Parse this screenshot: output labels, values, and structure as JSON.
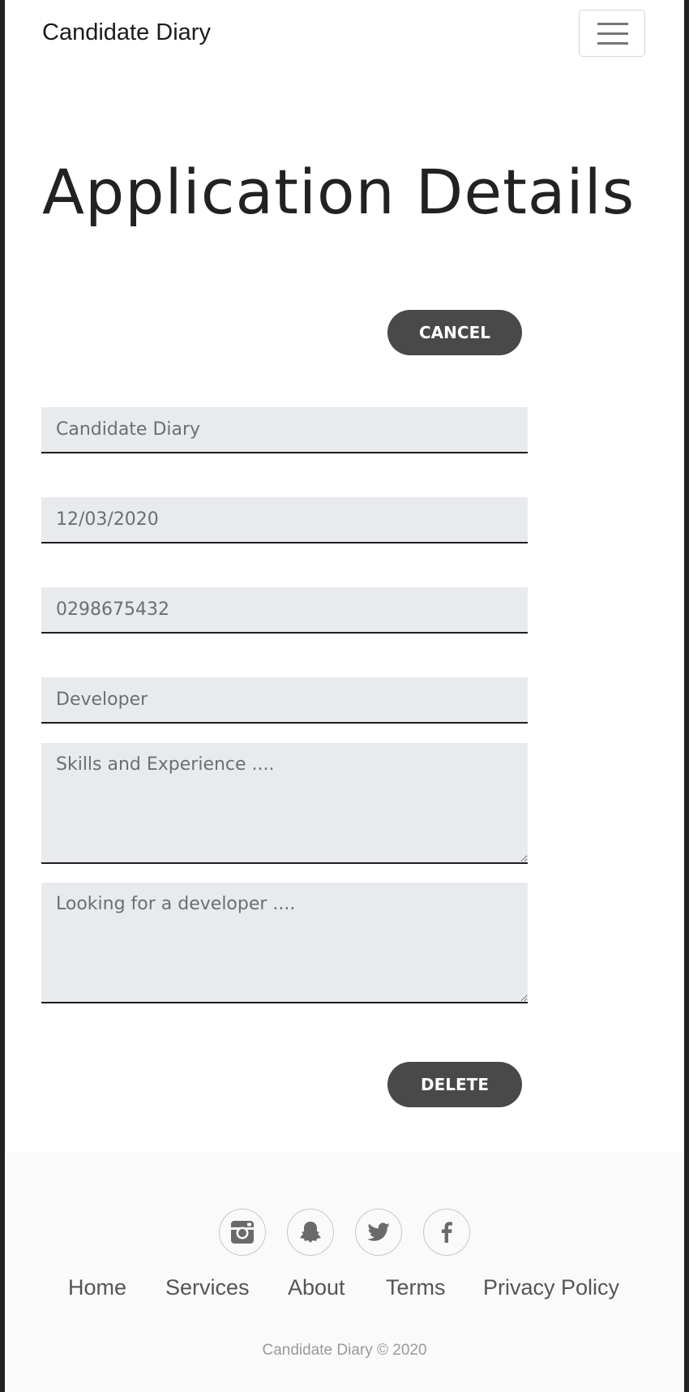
{
  "navbar": {
    "brand": "Candidate Diary",
    "menu_icon": "hamburger-menu-icon"
  },
  "page": {
    "title": "Application Details"
  },
  "buttons": {
    "cancel_label": "CANCEL",
    "delete_label": "DELETE"
  },
  "form": {
    "company_placeholder": "Candidate Diary",
    "date_placeholder": "12/03/2020",
    "phone_placeholder": "0298675432",
    "role_placeholder": "Developer",
    "skills_placeholder": "Skills and Experience ....",
    "notes_placeholder": "Looking for a developer ...."
  },
  "footer": {
    "social": [
      {
        "icon": "instagram-icon"
      },
      {
        "icon": "snapchat-icon"
      },
      {
        "icon": "twitter-icon"
      },
      {
        "icon": "facebook-icon"
      }
    ],
    "links": [
      "Home",
      "Services",
      "About",
      "Terms",
      "Privacy Policy"
    ],
    "copyright": "Candidate Diary © 2020"
  },
  "colors": {
    "button_bg": "#494949",
    "field_bg": "#e9eaed",
    "footer_bg": "#fafafa"
  }
}
